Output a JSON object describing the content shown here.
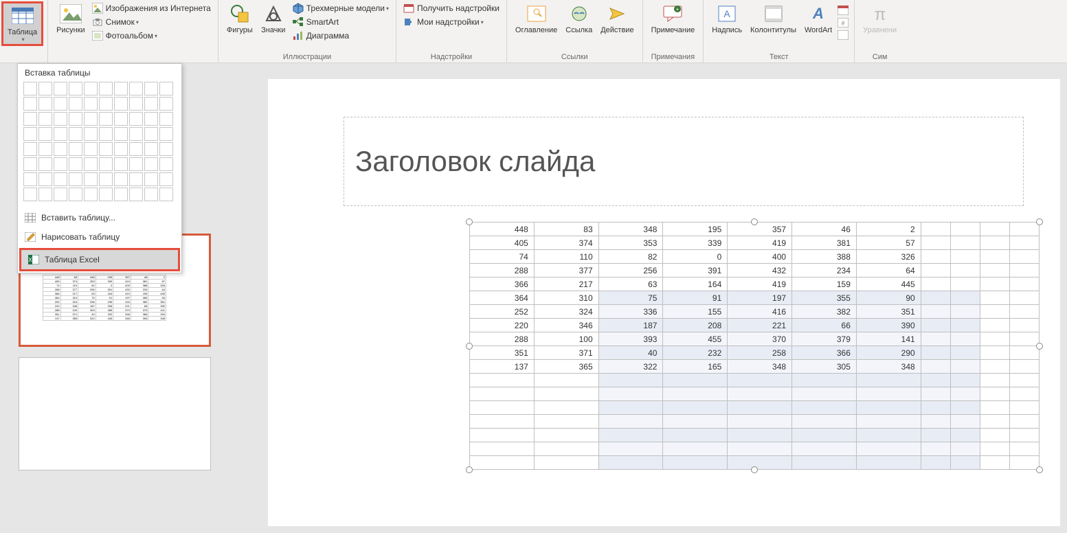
{
  "ribbon": {
    "table": "Таблица",
    "pictures": "Рисунки",
    "online_pic": "Изображения из Интернета",
    "screenshot": "Снимок",
    "photo_album": "Фотоальбом",
    "shapes": "Фигуры",
    "icons": "Значки",
    "3dmodels": "Трехмерные модели",
    "smartart": "SmartArt",
    "chart": "Диаграмма",
    "get_addins": "Получить надстройки",
    "my_addins": "Мои надстройки",
    "toc": "Оглавление",
    "link": "Ссылка",
    "action": "Действие",
    "comment": "Примечание",
    "textbox": "Надпись",
    "header_footer": "Колонтитулы",
    "wordart": "WordArt",
    "equation": "Уравнени",
    "grp_illustrations": "Иллюстрации",
    "grp_addins": "Надстройки",
    "grp_links": "Ссылки",
    "grp_comments": "Примечания",
    "grp_text": "Текст",
    "grp_sym": "Сим"
  },
  "table_menu": {
    "title": "Вставка таблицы",
    "insert": "Вставить таблицу...",
    "draw": "Нарисовать таблицу",
    "excel": "Таблица Excel"
  },
  "slide": {
    "title": "Заголовок слайда"
  },
  "data": {
    "rows": [
      [
        448,
        83,
        348,
        195,
        357,
        46,
        2,
        "",
        "",
        "",
        ""
      ],
      [
        405,
        374,
        353,
        339,
        419,
        381,
        57,
        "",
        "",
        "",
        ""
      ],
      [
        74,
        110,
        82,
        0,
        400,
        388,
        326,
        "",
        "",
        "",
        ""
      ],
      [
        288,
        377,
        256,
        391,
        432,
        234,
        64,
        "",
        "",
        "",
        ""
      ],
      [
        366,
        217,
        63,
        164,
        419,
        159,
        445,
        "",
        "",
        "",
        ""
      ],
      [
        364,
        310,
        75,
        91,
        197,
        355,
        90,
        "",
        "",
        "",
        ""
      ],
      [
        252,
        324,
        336,
        155,
        416,
        382,
        351,
        "",
        "",
        "",
        ""
      ],
      [
        220,
        346,
        187,
        208,
        221,
        66,
        390,
        "",
        "",
        "",
        ""
      ],
      [
        288,
        100,
        393,
        455,
        370,
        379,
        141,
        "",
        "",
        "",
        ""
      ],
      [
        351,
        371,
        40,
        232,
        258,
        366,
        290,
        "",
        "",
        "",
        ""
      ],
      [
        137,
        365,
        322,
        165,
        348,
        305,
        348,
        "",
        "",
        "",
        ""
      ],
      [
        "",
        "",
        "",
        "",
        "",
        "",
        "",
        "",
        "",
        "",
        ""
      ],
      [
        "",
        "",
        "",
        "",
        "",
        "",
        "",
        "",
        "",
        "",
        ""
      ],
      [
        "",
        "",
        "",
        "",
        "",
        "",
        "",
        "",
        "",
        "",
        ""
      ],
      [
        "",
        "",
        "",
        "",
        "",
        "",
        "",
        "",
        "",
        "",
        ""
      ],
      [
        "",
        "",
        "",
        "",
        "",
        "",
        "",
        "",
        "",
        "",
        ""
      ],
      [
        "",
        "",
        "",
        "",
        "",
        "",
        "",
        "",
        "",
        "",
        ""
      ],
      [
        "",
        "",
        "",
        "",
        "",
        "",
        "",
        "",
        "",
        "",
        ""
      ]
    ],
    "sel_col_start": 2,
    "sel_col_end": 8,
    "sel_row_start": 5
  }
}
